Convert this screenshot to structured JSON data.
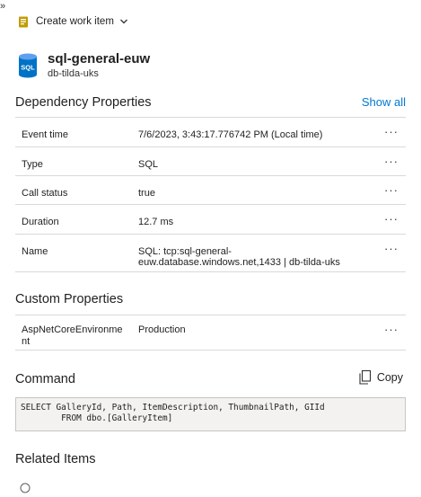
{
  "header": {
    "expand_glyph": "»"
  },
  "toolbar": {
    "create_label": "Create work item",
    "icon": "work-item-icon"
  },
  "resource": {
    "name": "sql-general-euw",
    "subtitle": "db-tilda-uks",
    "icon": "sql-database-icon",
    "icon_text": "SQL"
  },
  "dependency": {
    "title": "Dependency Properties",
    "show_all": "Show all",
    "rows": [
      {
        "key": "Event time",
        "value": "7/6/2023, 3:43:17.776742 PM (Local time)"
      },
      {
        "key": "Type",
        "value": "SQL"
      },
      {
        "key": "Call status",
        "value": "true"
      },
      {
        "key": "Duration",
        "value": "12.7 ms"
      },
      {
        "key": "Name",
        "value": "SQL: tcp:sql-general-euw.database.windows.net,1433 | db-tilda-uks"
      }
    ],
    "more_glyph": "···"
  },
  "custom": {
    "title": "Custom Properties",
    "rows": [
      {
        "key": "AspNetCoreEnvironment",
        "value": "Production"
      }
    ]
  },
  "command": {
    "title": "Command",
    "copy_label": "Copy",
    "code": "SELECT GalleryId, Path, ItemDescription, ThumbnailPath, GIId\n        FROM dbo.[GalleryItem]"
  },
  "related": {
    "title": "Related Items"
  },
  "colors": {
    "accent": "#0078d4",
    "sql_blue": "#0072c6",
    "code_bg": "#f3f2f1",
    "divider": "#d9d9d9"
  }
}
